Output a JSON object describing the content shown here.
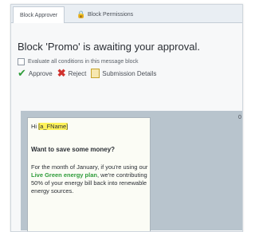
{
  "tabs": [
    {
      "label": "Block Approver"
    },
    {
      "label": "Block Permissions"
    }
  ],
  "heading": "Block 'Promo' is awaiting your approval.",
  "evaluate_label": "Evaluate all conditions in this message block",
  "actions": {
    "approve": "Approve",
    "reject": "Reject",
    "details": "Submission Details"
  },
  "message": {
    "greeting": "Hi ",
    "fname_token": "[a_FName]",
    "title": "Want to save some money?",
    "body_1": "For the month of January, if you're using our ",
    "green_text": "Live Green energy plan",
    "body_2": ", we're contributing 50% of your energy bill back into renewable energy sources."
  },
  "right_edge_text": "0"
}
